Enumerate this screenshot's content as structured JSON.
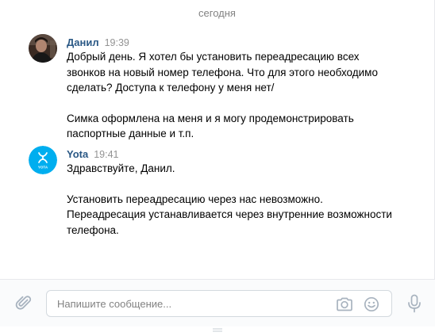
{
  "chat": {
    "date_separator": "сегодня",
    "messages": [
      {
        "author": "Данил",
        "time": "19:39",
        "avatar_icon": "user-photo",
        "paragraphs": [
          "Добрый день. Я хотел бы установить переадресацию всех звонков на новый номер телефона. Что для этого необходимо сделать? Доступа к телефону у меня нет/",
          "Симка оформлена на меня и я могу продемонстрировать паспортные данные и т.п."
        ]
      },
      {
        "author": "Yota",
        "time": "19:41",
        "avatar_icon": "yota-logo",
        "avatar_text": "YOTA",
        "paragraphs": [
          "Здравствуйте, Данил.",
          "Установить переадресацию через нас невозможно. Переадресация устанавливается через внутренние возможности телефона."
        ]
      }
    ]
  },
  "composer": {
    "placeholder": "Напишите сообщение...",
    "icons": [
      "paperclip-icon",
      "camera-icon",
      "smile-icon",
      "microphone-icon"
    ]
  },
  "colors": {
    "author": "#2a5885",
    "time": "#939393",
    "yota_brand": "#00aeef",
    "icon": "#a8b3bf"
  }
}
